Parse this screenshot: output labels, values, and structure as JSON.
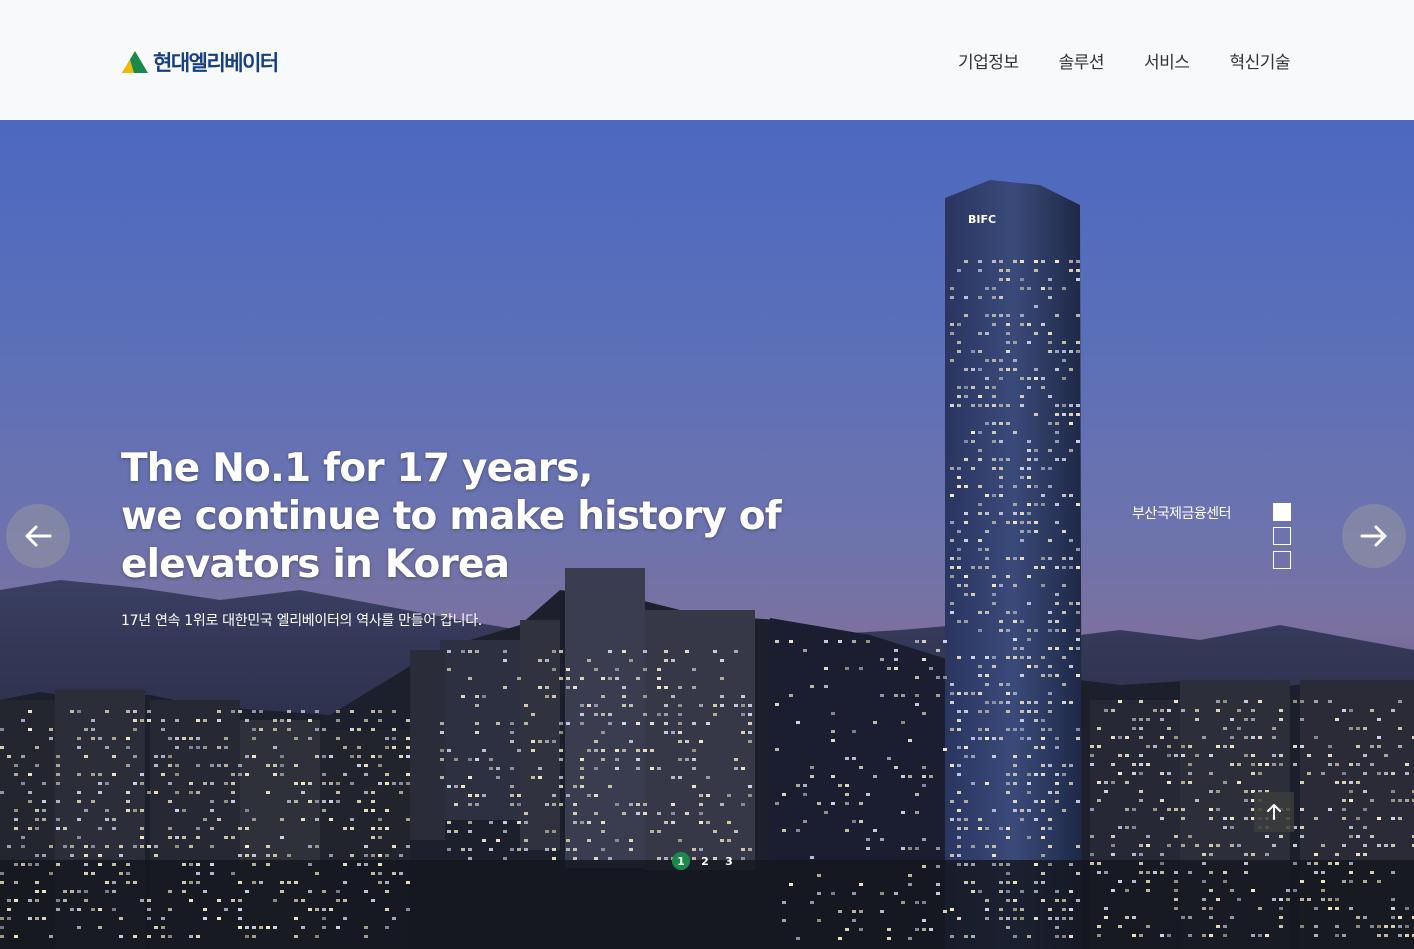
{
  "header": {
    "logo_text": "현대엘리베이터",
    "nav": [
      "기업정보",
      "솔루션",
      "서비스",
      "혁신기술"
    ]
  },
  "hero": {
    "title_lines": [
      "The No.1 for 17 years,",
      "we continue to make history of",
      "elevators in Korea"
    ],
    "subtitle": "17년 연속 1위로 대한민국 엘리베이터의 역사를 만들어 갑니다.",
    "location_label": "부산국제금융센터",
    "building_sign": "BIFC",
    "pager": [
      "1",
      "2",
      "3"
    ],
    "active_slide": 1,
    "active_thumb": 1
  },
  "colors": {
    "brand_blue": "#173f84",
    "brand_green": "#1a8a4a",
    "logo_yellow": "#f0b800"
  },
  "icons": {
    "prev": "arrow-left-icon",
    "next": "arrow-right-icon",
    "top": "arrow-up-icon"
  }
}
